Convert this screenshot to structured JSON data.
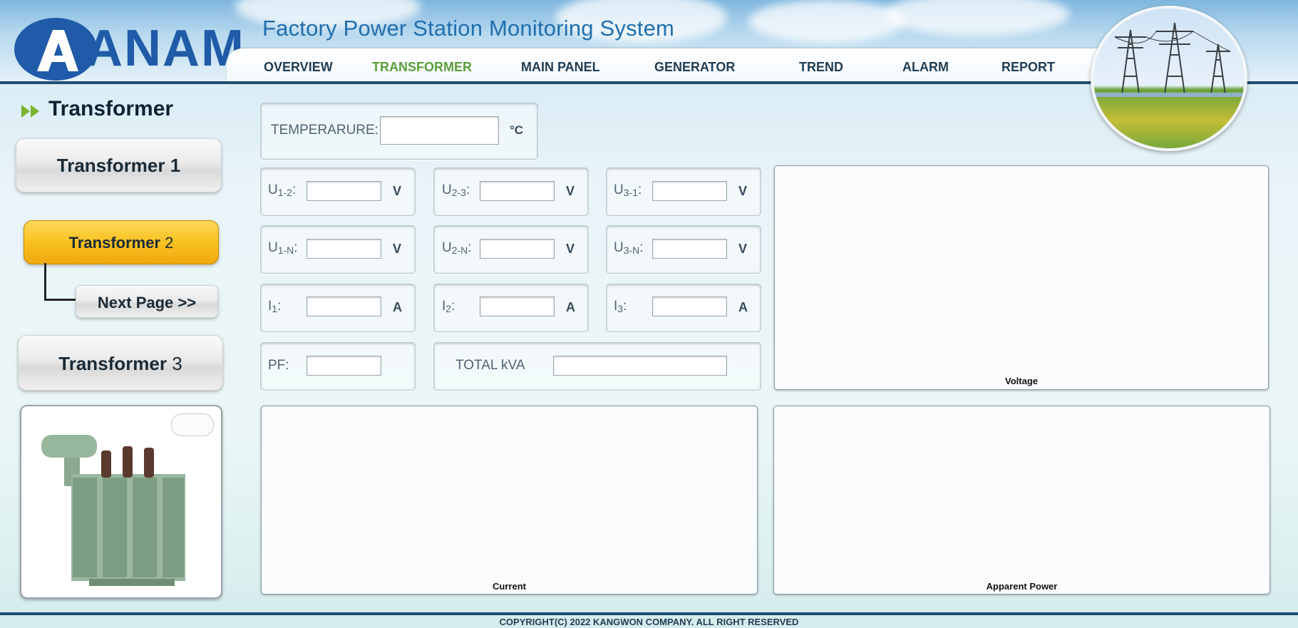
{
  "header": {
    "logo_text": "ANAM",
    "title": "Factory Power Station Monitoring System",
    "nav": [
      "OVERVIEW",
      "TRANSFORMER",
      "MAIN PANEL",
      "GENERATOR",
      "TREND",
      "ALARM",
      "REPORT"
    ],
    "active_nav": "TRANSFORMER",
    "brand_color": "#1f5ba8",
    "active_color": "#5b9e3c"
  },
  "sidebar": {
    "title": "Transformer",
    "items": [
      {
        "label": "Transformer ",
        "num": "1"
      },
      {
        "label": "Transformer ",
        "num": "2"
      },
      {
        "label": "Transformer ",
        "num": "3"
      }
    ],
    "next_page": "Next Page >>",
    "image_icon": "transformer-image"
  },
  "readings": {
    "temperature_label": "TEMPERARURE:",
    "temperature_unit": "°C",
    "u12": {
      "pre": "U",
      "sub": "1-2",
      "post": ":",
      "unit": "V",
      "value": ""
    },
    "u23": {
      "pre": "U",
      "sub": "2-3",
      "post": ":",
      "unit": "V",
      "value": ""
    },
    "u31": {
      "pre": "U",
      "sub": "3-1",
      "post": ":",
      "unit": "V",
      "value": ""
    },
    "u1n": {
      "pre": "U",
      "sub": "1-N",
      "post": ":",
      "unit": "V",
      "value": ""
    },
    "u2n": {
      "pre": "U",
      "sub": "2-N",
      "post": ":",
      "unit": "V",
      "value": ""
    },
    "u3n": {
      "pre": "U",
      "sub": "3-N",
      "post": ":",
      "unit": "V",
      "value": ""
    },
    "i1": {
      "pre": "I",
      "sub": "1",
      "post": ":",
      "unit": "A",
      "value": ""
    },
    "i2": {
      "pre": "I",
      "sub": "2",
      "post": ":",
      "unit": "A",
      "value": ""
    },
    "i3": {
      "pre": "I",
      "sub": "3",
      "post": ":",
      "unit": "A",
      "value": ""
    },
    "pf_label": "PF:",
    "total_kva_label": "TOTAL kVA"
  },
  "charts": {
    "voltage": "Voltage",
    "current": "Current",
    "apparent_power": "Apparent Power"
  },
  "footer": {
    "copyright": "COPYRIGHT(C) 2022 KANGWON COMPANY. ALL RIGHT RESERVED"
  }
}
